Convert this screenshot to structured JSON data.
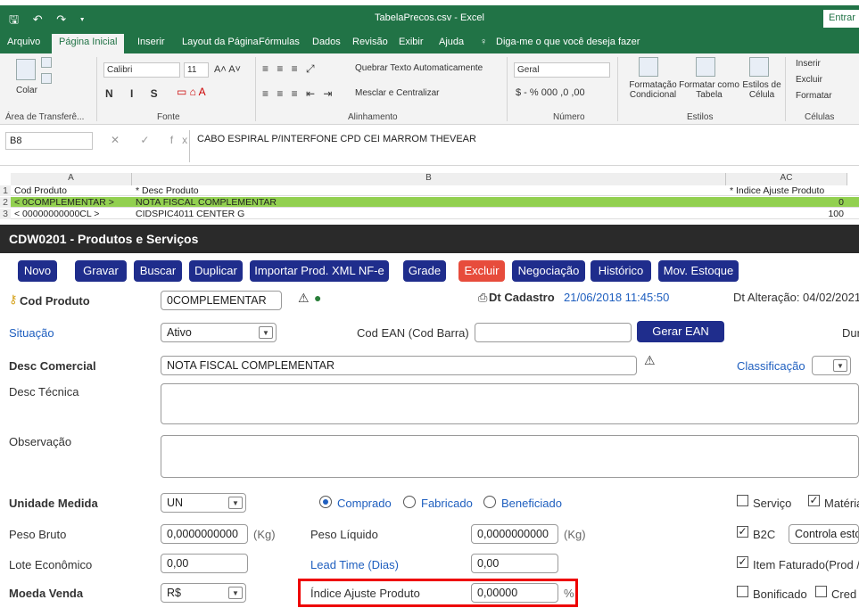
{
  "excel": {
    "title": "TabelaPrecos.csv - Excel",
    "signin": "Entrar",
    "tabs": [
      "Arquivo",
      "Página Inicial",
      "Inserir",
      "Layout da Página",
      "Fórmulas",
      "Dados",
      "Revisão",
      "Exibir",
      "Ajuda",
      "Diga-me o que você deseja fazer"
    ],
    "ribbon": {
      "clipboard_group": "Área de Transferê...",
      "paste": "Colar",
      "font_name": "Calibri",
      "font_size": "11",
      "font_group": "Fonte",
      "wrap": "Quebrar Texto Automaticamente",
      "merge": "Mesclar e Centralizar",
      "align_group": "Alinhamento",
      "number_format": "Geral",
      "number_group": "Número",
      "cond_format": "Formatação Condicional",
      "format_table": "Formatar como Tabela",
      "cell_styles": "Estilos de Célula",
      "styles_group": "Estilos",
      "insert": "Inserir",
      "delete": "Excluir",
      "format": "Formatar",
      "cells_group": "Células"
    },
    "name_box": "B8",
    "formula": "CABO ESPIRAL P/INTERFONE CPD CEI MARROM THEVEAR",
    "col_headers": [
      "A",
      "B",
      "AC"
    ],
    "rows": [
      {
        "n": "1",
        "a": "Cod Produto",
        "b": "* Desc Produto",
        "ac": "* Indice Ajuste Produto"
      },
      {
        "n": "2",
        "a": "< 0COMPLEMENTAR >",
        "b": "NOTA FISCAL COMPLEMENTAR",
        "ac": "0"
      },
      {
        "n": "3",
        "a": "< 00000000000CL >",
        "b": "CIDSPIC4011 CENTER G",
        "ac": "100"
      }
    ]
  },
  "app": {
    "title": "CDW0201 - Produtos e Serviços",
    "toolbar": [
      "Novo",
      "Gravar",
      "Buscar",
      "Duplicar",
      "Importar Prod. XML NF-e",
      "Grade",
      "Excluir",
      "Negociação",
      "Histórico",
      "Mov. Estoque"
    ],
    "cod_produto_label": "Cod Produto",
    "cod_produto": "0COMPLEMENTAR",
    "dt_cadastro_label": "Dt Cadastro",
    "dt_cadastro": "21/06/2018 11:45:50",
    "dt_alteracao": "Dt Alteração: 04/02/2021",
    "situacao_label": "Situação",
    "situacao": "Ativo",
    "cod_ean_label": "Cod EAN (Cod Barra)",
    "gerar_ean": "Gerar EAN",
    "dur_label": "Dur",
    "desc_comercial_label": "Desc Comercial",
    "desc_comercial": "NOTA FISCAL COMPLEMENTAR",
    "classificacao_label": "Classificação",
    "desc_tecnica_label": "Desc Técnica",
    "observacao_label": "Observação",
    "unidade_label": "Unidade Medida",
    "unidade": "UN",
    "radios": [
      "Comprado",
      "Fabricado",
      "Beneficiado"
    ],
    "servico": "Serviço",
    "materia": "Matéria",
    "peso_bruto_label": "Peso Bruto",
    "peso_bruto": "0,0000000000",
    "kg": "(Kg)",
    "peso_liquido_label": "Peso Líquido",
    "peso_liquido": "0,0000000000",
    "b2c": "B2C",
    "controla": "Controla esto",
    "lote_label": "Lote Econômico",
    "lote": "0,00",
    "lead_label": "Lead Time (Dias)",
    "lead": "0,00",
    "item_faturado": "Item Faturado(Prod /",
    "moeda_label": "Moeda Venda",
    "moeda": "R$",
    "indice_label": "Índice Ajuste Produto",
    "indice": "0,00000",
    "pct": "%",
    "bonificado": "Bonificado",
    "cred": "Cred"
  }
}
